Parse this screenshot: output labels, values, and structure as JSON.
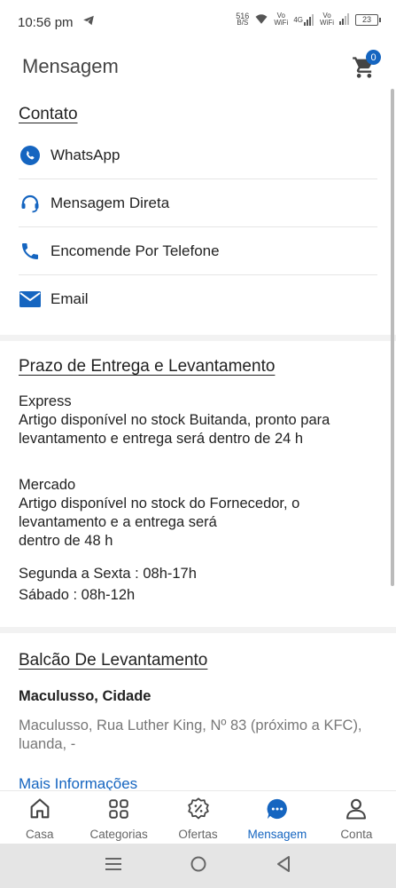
{
  "status": {
    "time": "10:56 pm",
    "speed_top": "516",
    "speed_bottom": "B/S",
    "volte1_top": "Vo",
    "volte1_bottom": "WiFi",
    "network": "4G",
    "volte2_top": "Vo",
    "volte2_bottom": "WiFi",
    "battery": "23"
  },
  "header": {
    "title": "Mensagem",
    "cart_count": "0"
  },
  "contact": {
    "title": "Contato",
    "items": [
      {
        "label": "WhatsApp",
        "icon": "whatsapp-icon"
      },
      {
        "label": "Mensagem Direta",
        "icon": "headset-icon"
      },
      {
        "label": "Encomende Por Telefone",
        "icon": "phone-icon"
      },
      {
        "label": "Email",
        "icon": "mail-icon"
      }
    ]
  },
  "prazo": {
    "title": "Prazo de Entrega e Levantamento",
    "express_label": "Express",
    "express_text": "Artigo disponível no stock Buitanda, pronto para levantamento e entrega  será dentro de 24 h",
    "mercado_label": "Mercado",
    "mercado_text_1": "Artigo disponível no stock do Fornecedor, o levantamento e a entrega será",
    "mercado_text_2": "dentro de 48 h",
    "hours_weekday": "Segunda a Sexta : 08h-17h",
    "hours_saturday": "Sábado : 08h-12h"
  },
  "balcao": {
    "title": "Balcão De Levantamento",
    "shop_name": "Maculusso, Cidade",
    "shop_address": "Maculusso, Rua Luther King, Nº 83 (próximo a KFC), luanda, -",
    "more_link": "Mais Informações"
  },
  "bottom_nav": [
    {
      "label": "Casa",
      "icon": "home-icon"
    },
    {
      "label": "Categorias",
      "icon": "grid-icon"
    },
    {
      "label": "Ofertas",
      "icon": "offer-badge-icon"
    },
    {
      "label": "Mensagem",
      "icon": "chat-icon"
    },
    {
      "label": "Conta",
      "icon": "user-icon"
    }
  ],
  "colors": {
    "accent": "#1565c0",
    "text": "#222222",
    "muted": "#777777"
  }
}
